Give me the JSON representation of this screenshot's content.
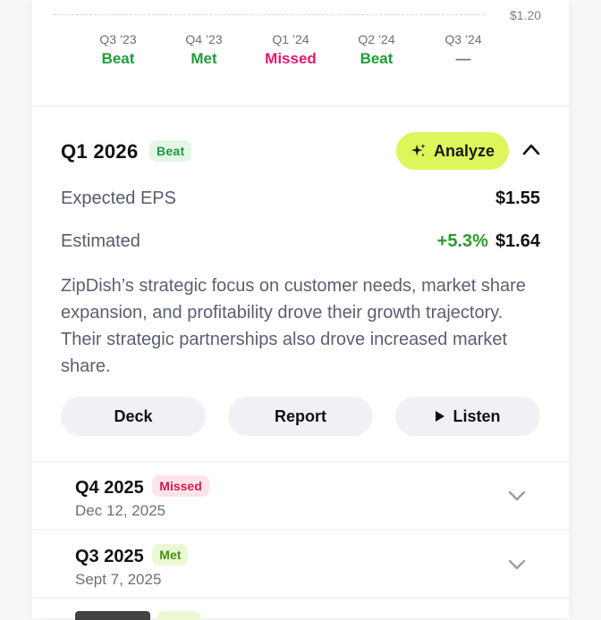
{
  "chart": {
    "price_label": "$1.20",
    "quarters": [
      {
        "label": "Q3 ’23",
        "status": "Beat"
      },
      {
        "label": "Q4 ’23",
        "status": "Met"
      },
      {
        "label": "Q1 ’24",
        "status": "Missed"
      },
      {
        "label": "Q2 ’24",
        "status": "Beat"
      },
      {
        "label": "Q3 ’24",
        "status": "—"
      }
    ]
  },
  "expanded": {
    "title": "Q1 2026",
    "badge": "Beat",
    "analyze_label": "Analyze",
    "expected_label": "Expected EPS",
    "expected_value": "$1.55",
    "estimated_label": "Estimated",
    "estimated_change": "+5.3%",
    "estimated_value": "$1.64",
    "summary": "ZipDish’s strategic focus on customer needs, market share expansion, and profitability drove their growth trajectory. Their strategic partnerships also drove increased market share.",
    "buttons": {
      "deck": "Deck",
      "report": "Report",
      "listen": "Listen"
    }
  },
  "rows": [
    {
      "title": "Q4 2025",
      "badge": "Missed",
      "date": "Dec 12, 2025"
    },
    {
      "title": "Q3 2025",
      "badge": "Met",
      "date": "Sept 7, 2025"
    }
  ],
  "colors": {
    "accent": "#def55b",
    "beat": "#1e9e36",
    "missed": "#e3186e",
    "positive": "#2e9a2e"
  },
  "icons": {
    "analyze": "sparkle-icon",
    "collapse": "chevron-up-icon",
    "expand": "chevron-down-icon",
    "listen": "play-icon"
  }
}
